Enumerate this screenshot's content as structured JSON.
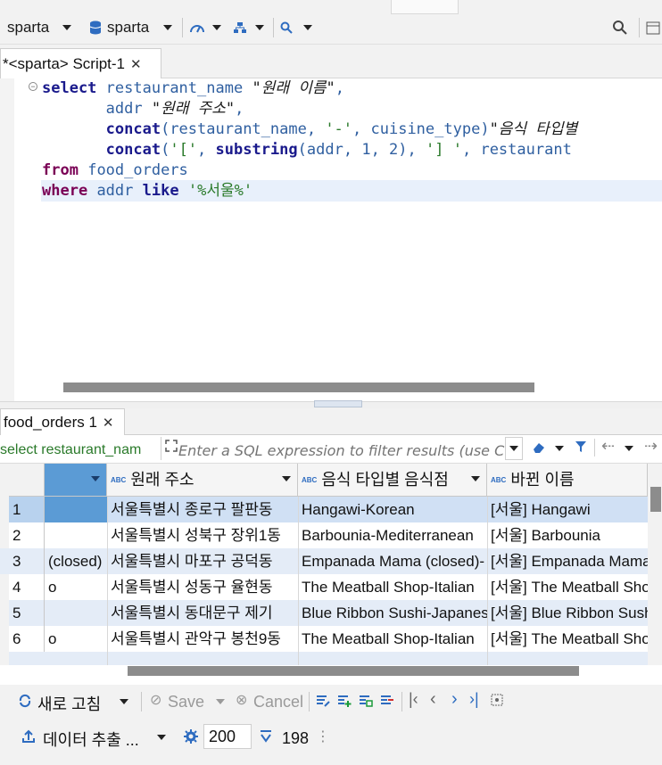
{
  "toolbar": {
    "connection": "sparta",
    "database": "sparta"
  },
  "editor_tab": {
    "label": "*<sparta> Script-1"
  },
  "sql": {
    "l1_kw": "select",
    "l1_col": "restaurant_name",
    "l1_alias": "\"원래 이름\"",
    "l2_col": "addr",
    "l2_alias": "\"원래 주소\"",
    "l3_fn": "concat",
    "l3_args_a": "(restaurant_name, ",
    "l3_str": "'-'",
    "l3_args_b": ", cuisine_type)",
    "l3_alias": "\"음식 타입별",
    "l4_fn": "concat",
    "l4_str1": "'['",
    "l4_fn2": "substring",
    "l4_args": "(addr, ",
    "l4_n1": "1",
    "l4_n2": "2",
    "l4_str2": "'] '",
    "l4_tail": "restaurant",
    "l5_kw": "from",
    "l5_tbl": "food_orders",
    "l6_kw": "where",
    "l6_col": "addr",
    "l6_kw2": "like",
    "l6_str": "'%서울%'"
  },
  "results_tab": {
    "label": "food_orders 1"
  },
  "filter": {
    "sql_preview": "select restaurant_nam",
    "placeholder": "Enter a SQL expression to filter results (use Ctrl+Space)"
  },
  "grid": {
    "columns": [
      "원래 주소",
      "음식 타입별 음식점",
      "바뀐 이름"
    ],
    "rows": [
      {
        "num": "1",
        "c0": "",
        "c1": "서울특별시 종로구 팔판동",
        "c2": "Hangawi-Korean",
        "c3": "[서울] Hangawi"
      },
      {
        "num": "2",
        "c0": "",
        "c1": "서울특별시 성북구 장위1동",
        "c2": "Barbounia-Mediterranean",
        "c3": "[서울] Barbounia"
      },
      {
        "num": "3",
        "c0": "(closed)",
        "c1": "서울특별시 마포구 공덕동",
        "c2": "Empanada Mama (closed)-",
        "c3": "[서울] Empanada Mama"
      },
      {
        "num": "4",
        "c0": "o",
        "c1": "서울특별시 성동구 율현동",
        "c2": "The Meatball Shop-Italian",
        "c3": "[서울] The Meatball Shop"
      },
      {
        "num": "5",
        "c0": "",
        "c1": "서울특별시 동대문구 제기",
        "c2": "Blue Ribbon Sushi-Japanese",
        "c3": "[서울] Blue Ribbon Sushi"
      },
      {
        "num": "6",
        "c0": "o",
        "c1": "서울특별시 관악구 봉천9동",
        "c2": "The Meatball Shop-Italian",
        "c3": "[서울] The Meatball Shop"
      }
    ]
  },
  "bottom": {
    "refresh": "새로 고침",
    "save": "Save",
    "cancel": "Cancel",
    "export": "데이터 추출 ...",
    "fetch_size": "200",
    "row_count": "198"
  }
}
